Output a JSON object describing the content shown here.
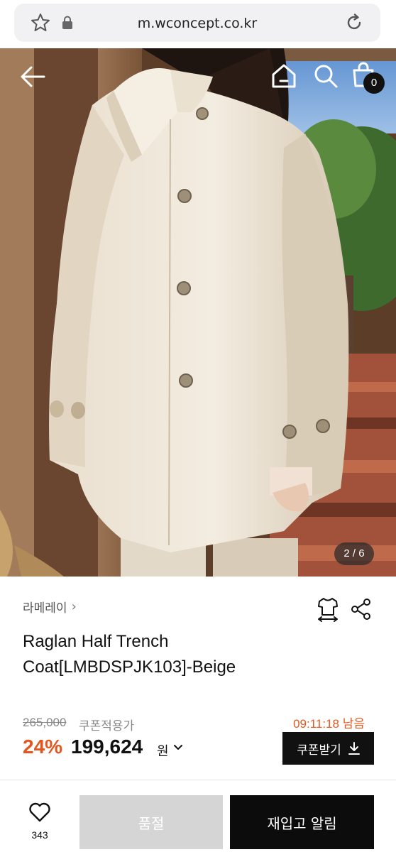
{
  "browser": {
    "url": "m.wconcept.co.kr",
    "icons": {
      "favorite": "star-icon",
      "secure": "lock-icon",
      "reload": "reload-icon"
    }
  },
  "header": {
    "icons": {
      "back": "back-arrow-icon",
      "home": "home-icon",
      "search": "search-icon",
      "bag": "shopping-bag-icon"
    },
    "cart_count": "0"
  },
  "gallery": {
    "counter": "2 / 6"
  },
  "product": {
    "brand": "라메레이",
    "title": "Raglan Half Trench Coat[LMBDSPJK103]-Beige",
    "original_price": "265,000",
    "coupon_price_label": "쿠폰적용가",
    "timer": "09:11:18 남음",
    "discount": "24%",
    "sale_price": "199,624",
    "currency": "원",
    "coupon_button": "쿠폰받기"
  },
  "bottom_bar": {
    "wish_count": "343",
    "soldout_label": "품절",
    "restock_label": "재입고 알림"
  },
  "colors": {
    "accent": "#e5561e",
    "button_dark": "#111111",
    "soldout_gray": "#d5d5d5"
  }
}
